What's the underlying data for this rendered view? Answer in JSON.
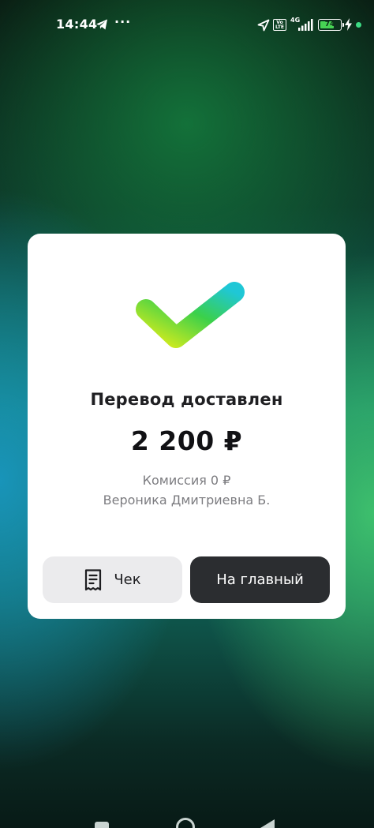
{
  "status_bar": {
    "time": "14:44",
    "more": "···",
    "volte": "Vo LTE",
    "network": "4G",
    "battery": "74",
    "battery_level": 0.74,
    "icons": [
      "telegram-icon",
      "location-icon",
      "signal-icon",
      "battery-icon",
      "charging-icon"
    ]
  },
  "card": {
    "title": "Перевод доставлен",
    "amount": "2 200 ₽",
    "fee": "Комиссия 0 ₽",
    "recipient": "Вероника Дмитриевна Б.",
    "icon": "success-check-icon",
    "receipt_button": {
      "label": "Чек",
      "icon": "receipt-icon"
    },
    "home_button": {
      "label": "На главный"
    }
  },
  "colors": {
    "check_gradient": [
      "#d7ec1c",
      "#3bd04a",
      "#1fc7d6"
    ],
    "home_button_bg": "#2b2d30",
    "receipt_button_bg": "#ebebed",
    "battery_fill": "#47d454",
    "notification_dot": "#3ddc84"
  },
  "nav_bar": {
    "icons": [
      "recents-icon",
      "home-icon",
      "back-icon"
    ]
  }
}
